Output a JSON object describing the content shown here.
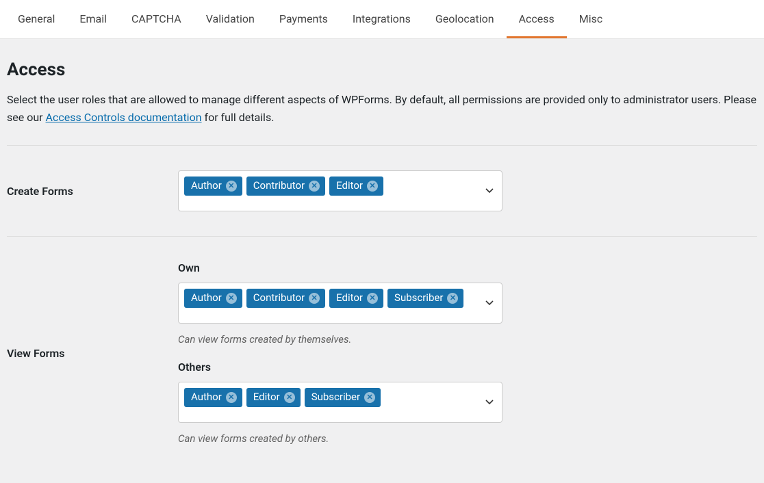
{
  "tabs": [
    {
      "label": "General"
    },
    {
      "label": "Email"
    },
    {
      "label": "CAPTCHA"
    },
    {
      "label": "Validation"
    },
    {
      "label": "Payments"
    },
    {
      "label": "Integrations"
    },
    {
      "label": "Geolocation"
    },
    {
      "label": "Access",
      "active": true
    },
    {
      "label": "Misc"
    }
  ],
  "page": {
    "title": "Access",
    "desc_before": "Select the user roles that are allowed to manage different aspects of WPForms. By default, all permissions are provided only to administrator users. Please see our ",
    "desc_link": "Access Controls documentation",
    "desc_after": " for full details."
  },
  "settings": {
    "create_forms": {
      "label": "Create Forms",
      "roles": [
        "Author",
        "Contributor",
        "Editor"
      ]
    },
    "view_forms": {
      "label": "View Forms",
      "own": {
        "sub_label": "Own",
        "roles": [
          "Author",
          "Contributor",
          "Editor",
          "Subscriber"
        ],
        "help": "Can view forms created by themselves."
      },
      "others": {
        "sub_label": "Others",
        "roles": [
          "Author",
          "Editor",
          "Subscriber"
        ],
        "help": "Can view forms created by others."
      }
    }
  }
}
